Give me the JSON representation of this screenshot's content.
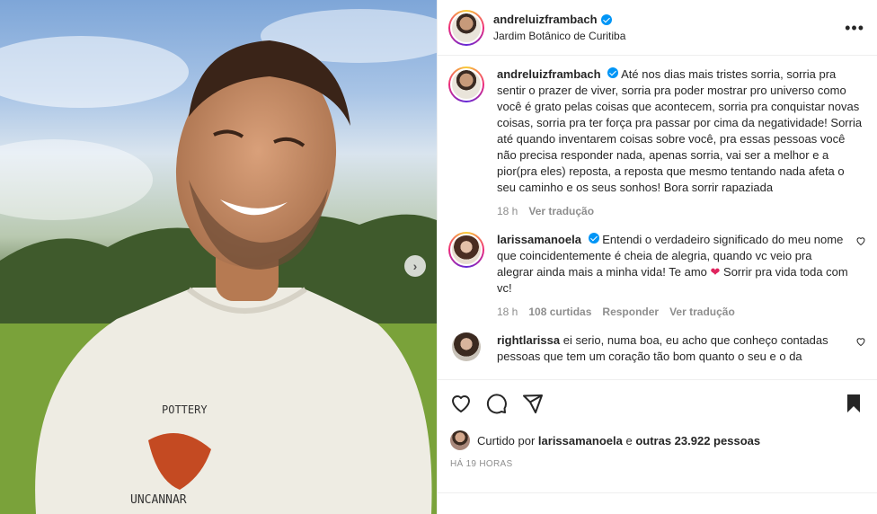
{
  "post": {
    "author": "andreluizframbach",
    "location": "Jardim Botânico de Curitiba",
    "more_label": "•••",
    "carousel_next": "›"
  },
  "caption": {
    "username": "andreluizframbach",
    "text": "Até nos dias mais tristes sorria, sorria pra sentir o prazer de viver, sorria pra poder mostrar pro universo como você é grato pelas coisas que acontecem, sorria pra conquistar novas coisas, sorria pra ter força pra passar por cima da negatividade! Sorria até quando inventarem coisas sobre você, pra essas pessoas você não precisa responder nada, apenas sorria, vai ser a melhor e a pior(pra eles) reposta, a reposta que mesmo tentando nada afeta o seu caminho e os seus sonhos! Bora sorrir rapaziada",
    "time": "18 h",
    "see_translation": "Ver tradução"
  },
  "comments": [
    {
      "username": "larissamanoela",
      "verified": true,
      "text_before": "Entendi o verdadeiro significado do meu nome que coincidentemente é cheia de alegria, quando vc veio pra alegrar ainda mais a minha vida! Te amo ",
      "emoji": "❤",
      "text_after": " Sorrir pra vida toda com vc!",
      "time": "18 h",
      "likes": "108 curtidas",
      "reply": "Responder",
      "see_translation": "Ver tradução"
    },
    {
      "username": "rightlarissa",
      "verified": false,
      "text": "ei serio, numa boa, eu acho que conheço contadas pessoas que tem um coração tão bom quanto o seu e o da"
    }
  ],
  "likes": {
    "prefix": "Curtido por ",
    "user": "larissamanoela",
    "middle": " e ",
    "others": "outras 23.922 pessoas"
  },
  "time_ago": "HÁ 19 HORAS",
  "icons": {
    "like": "heart-icon",
    "comment": "comment-icon",
    "share": "share-icon",
    "save": "bookmark-icon",
    "verified": "verified-badge-icon"
  },
  "colors": {
    "verified": "#0095f6",
    "heart_emoji": "#e0245e",
    "text": "#262626",
    "muted": "#8e8e8e"
  }
}
